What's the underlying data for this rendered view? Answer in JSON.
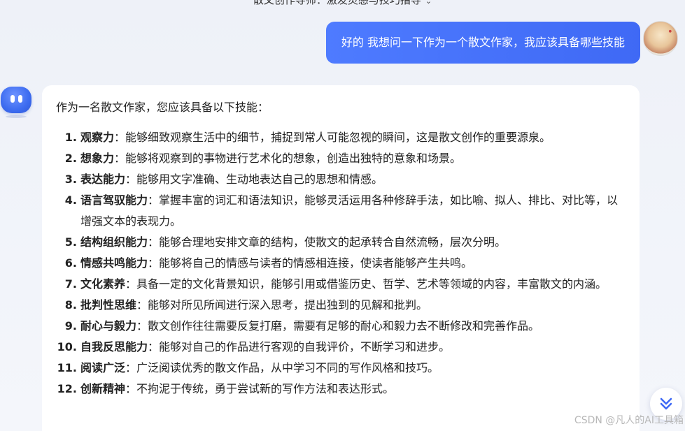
{
  "header": {
    "title": "散文创作导师：激发灵感与技巧指导"
  },
  "user_message": {
    "text": "好的 我想问一下作为一个散文作家，我应该具备哪些技能"
  },
  "answer": {
    "intro": "作为一名散文作家，您应该具备以下技能：",
    "items": [
      {
        "num": "1.",
        "term": "观察力",
        "desc": "：能够细致观察生活中的细节，捕捉到常人可能忽视的瞬间，这是散文创作的重要源泉。"
      },
      {
        "num": "2.",
        "term": "想象力",
        "desc": "：能够将观察到的事物进行艺术化的想象，创造出独特的意象和场景。"
      },
      {
        "num": "3.",
        "term": "表达能力",
        "desc": "：能够用文字准确、生动地表达自己的思想和情感。"
      },
      {
        "num": "4.",
        "term": "语言驾驭能力",
        "desc": "：掌握丰富的词汇和语法知识，能够灵活运用各种修辞手法，如比喻、拟人、排比、对比等，以增强文本的表现力。"
      },
      {
        "num": "5.",
        "term": "结构组织能力",
        "desc": "：能够合理地安排文章的结构，使散文的起承转合自然流畅，层次分明。"
      },
      {
        "num": "6.",
        "term": "情感共鸣能力",
        "desc": "：能够将自己的情感与读者的情感相连接，使读者能够产生共鸣。"
      },
      {
        "num": "7.",
        "term": "文化素养",
        "desc": "：具备一定的文化背景知识，能够引用或借鉴历史、哲学、艺术等领域的内容，丰富散文的内涵。"
      },
      {
        "num": "8.",
        "term": "批判性思维",
        "desc": "：能够对所见所闻进行深入思考，提出独到的见解和批判。"
      },
      {
        "num": "9.",
        "term": "耐心与毅力",
        "desc": "：散文创作往往需要反复打磨，需要有足够的耐心和毅力去不断修改和完善作品。"
      },
      {
        "num": "10.",
        "term": "自我反思能力",
        "desc": "：能够对自己的作品进行客观的自我评价，不断学习和进步。"
      },
      {
        "num": "11.",
        "term": "阅读广泛",
        "desc": "：广泛阅读优秀的散文作品，从中学习不同的写作风格和技巧。"
      },
      {
        "num": "12.",
        "term": "创新精神",
        "desc": "：不拘泥于传统，勇于尝试新的写作方法和表达形式。"
      }
    ]
  },
  "watermark": "CSDN @凡人的AI工具箱",
  "icons": {
    "title_chevron": "chevron-down-icon",
    "scroll": "double-chevron-down-icon"
  },
  "colors": {
    "accent": "#4470f7",
    "background": "#f3f5fa"
  }
}
